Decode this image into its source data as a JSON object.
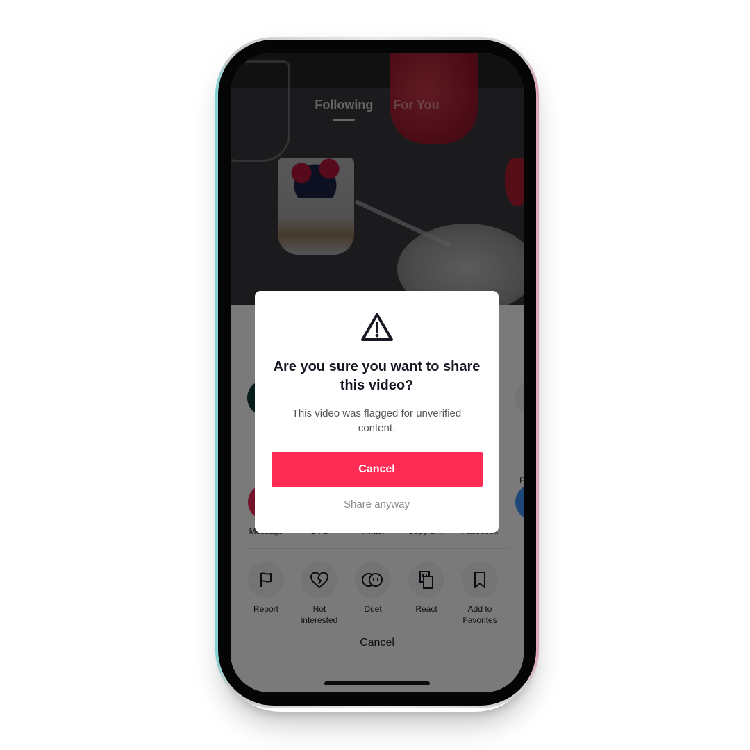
{
  "feed": {
    "tabs": [
      {
        "label": "Following",
        "active": true
      },
      {
        "label": "For You",
        "active": false
      }
    ]
  },
  "dialog": {
    "icon": "warning-triangle-icon",
    "title": "Are you sure you want to share this video?",
    "message": "This video was flagged for unverified content.",
    "primary_label": "Cancel",
    "secondary_label": "Share anyway",
    "primary_color": "#fe2c55"
  },
  "share_sheet": {
    "partial_contact_label": "F",
    "share_targets": [
      {
        "label": "Message",
        "icon": "send-icon",
        "color": "#e6264e"
      },
      {
        "label": "SMS",
        "icon": "sms-bubble-icon",
        "color": "#2bb34a"
      },
      {
        "label": "Twitter",
        "icon": "twitter-bird-icon",
        "color": "#3d9ae8"
      },
      {
        "label": "Copy Link",
        "icon": "link-icon",
        "color": "#5b6de8"
      },
      {
        "label": "Facebook",
        "icon": "facebook-icon",
        "color": "#1877f2"
      }
    ],
    "actions": [
      {
        "label": "Report",
        "icon": "flag-icon"
      },
      {
        "label": "Not interested",
        "icon": "broken-heart-icon"
      },
      {
        "label": "Duet",
        "icon": "duet-icon"
      },
      {
        "label": "React",
        "icon": "react-icon"
      },
      {
        "label": "Add to Favorites",
        "icon": "bookmark-icon"
      }
    ],
    "cancel_label": "Cancel"
  }
}
